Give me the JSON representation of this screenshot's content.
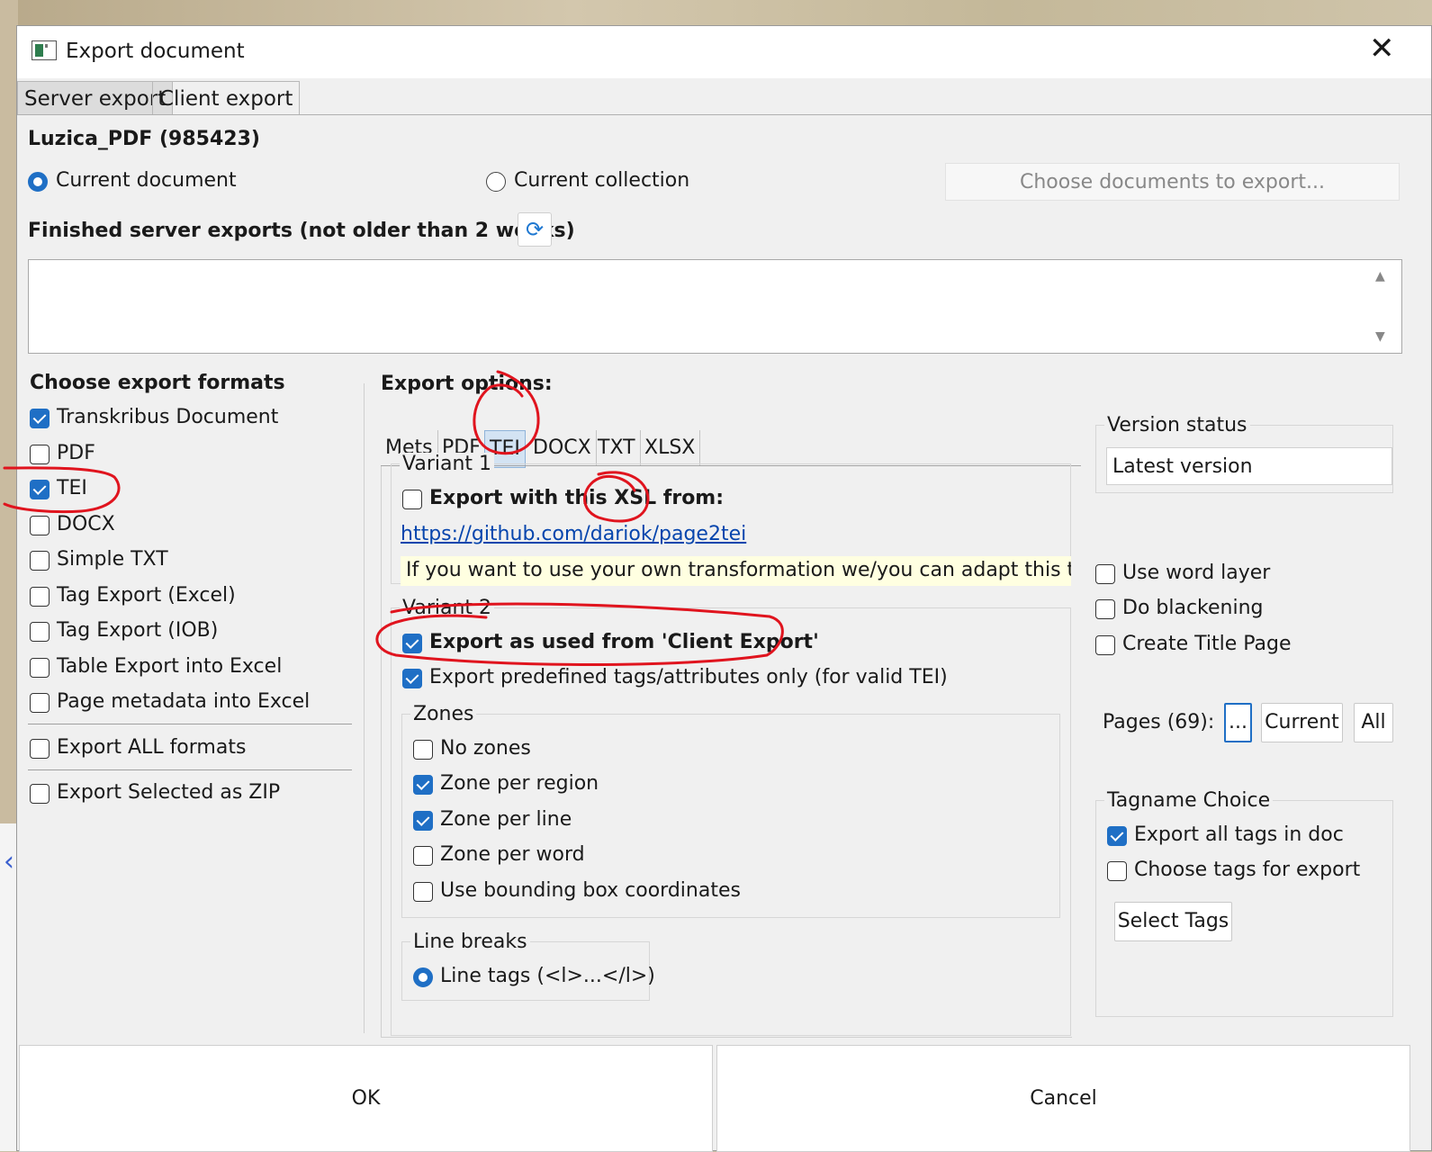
{
  "window": {
    "title": "Export document"
  },
  "tabs": [
    {
      "label": "Server export",
      "selected": true
    },
    {
      "label": "Client export",
      "selected": false
    }
  ],
  "document": {
    "name": "Luzica_PDF (985423)"
  },
  "scope": {
    "current_document": "Current document",
    "current_collection": "Current collection",
    "choose_documents_button": "Choose documents to export..."
  },
  "finished_exports": {
    "label": "Finished server exports (not older than 2 weeks)"
  },
  "formats": {
    "heading": "Choose export formats",
    "items": [
      {
        "label": "Transkribus Document",
        "checked": true
      },
      {
        "label": "PDF",
        "checked": false
      },
      {
        "label": "TEI",
        "checked": true
      },
      {
        "label": "DOCX",
        "checked": false
      },
      {
        "label": "Simple TXT",
        "checked": false
      },
      {
        "label": "Tag Export (Excel)",
        "checked": false
      },
      {
        "label": "Tag Export (IOB)",
        "checked": false
      },
      {
        "label": "Table Export into Excel",
        "checked": false
      },
      {
        "label": "Page metadata into Excel",
        "checked": false
      }
    ],
    "export_all": "Export ALL formats",
    "export_zip": "Export Selected as ZIP"
  },
  "options": {
    "heading": "Export options:",
    "subtabs": [
      "Mets",
      "PDF",
      "TEI",
      "DOCX",
      "TXT",
      "XLSX"
    ],
    "selected_subtab": "TEI",
    "variant1": {
      "legend": "Variant 1",
      "xsl_label": "Export with this XSL from:",
      "link": "https://github.com/dariok/page2tei",
      "hint": "If you want to use your own transformation we/you can adapt this temp"
    },
    "variant2": {
      "legend": "Variant 2",
      "client_export_label": "Export as used from 'Client Export'",
      "predefined_label": "Export predefined tags/attributes only (for valid TEI)"
    },
    "zones": {
      "legend": "Zones",
      "items": [
        {
          "label": "No zones",
          "checked": false
        },
        {
          "label": "Zone per region",
          "checked": true
        },
        {
          "label": "Zone per line",
          "checked": true
        },
        {
          "label": "Zone per word",
          "checked": false
        },
        {
          "label": "Use bounding box coordinates",
          "checked": false
        }
      ]
    },
    "linebreaks": {
      "legend": "Line breaks",
      "line_tags": "Line tags (<l>...</l>)"
    }
  },
  "right_panel": {
    "version_status_legend": "Version status",
    "version_value": "Latest version",
    "use_word_layer": "Use word layer",
    "do_blackening": "Do blackening",
    "create_title_page": "Create Title Page",
    "pages_label": "Pages (69):",
    "pages_dots": "...",
    "current_button": "Current",
    "all_button": "All",
    "tagname_legend": "Tagname Choice",
    "export_all_tags": "Export all tags in doc",
    "choose_tags": "Choose tags for export",
    "select_tags_button": "Select Tags"
  },
  "footer": {
    "ok": "OK",
    "cancel": "Cancel"
  },
  "colors": {
    "accent": "#1f6fc5",
    "annotation": "#e0141e"
  }
}
